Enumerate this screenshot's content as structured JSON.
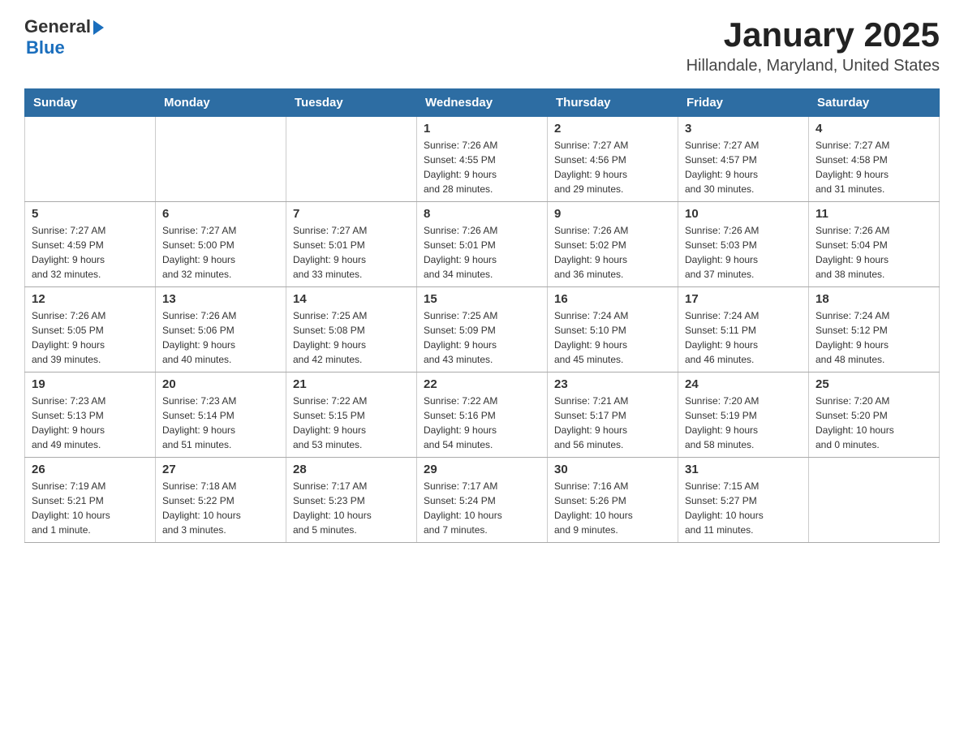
{
  "header": {
    "logo_general": "General",
    "logo_blue": "Blue",
    "title": "January 2025",
    "subtitle": "Hillandale, Maryland, United States"
  },
  "days_of_week": [
    "Sunday",
    "Monday",
    "Tuesday",
    "Wednesday",
    "Thursday",
    "Friday",
    "Saturday"
  ],
  "weeks": [
    [
      {
        "day": "",
        "info": ""
      },
      {
        "day": "",
        "info": ""
      },
      {
        "day": "",
        "info": ""
      },
      {
        "day": "1",
        "info": "Sunrise: 7:26 AM\nSunset: 4:55 PM\nDaylight: 9 hours\nand 28 minutes."
      },
      {
        "day": "2",
        "info": "Sunrise: 7:27 AM\nSunset: 4:56 PM\nDaylight: 9 hours\nand 29 minutes."
      },
      {
        "day": "3",
        "info": "Sunrise: 7:27 AM\nSunset: 4:57 PM\nDaylight: 9 hours\nand 30 minutes."
      },
      {
        "day": "4",
        "info": "Sunrise: 7:27 AM\nSunset: 4:58 PM\nDaylight: 9 hours\nand 31 minutes."
      }
    ],
    [
      {
        "day": "5",
        "info": "Sunrise: 7:27 AM\nSunset: 4:59 PM\nDaylight: 9 hours\nand 32 minutes."
      },
      {
        "day": "6",
        "info": "Sunrise: 7:27 AM\nSunset: 5:00 PM\nDaylight: 9 hours\nand 32 minutes."
      },
      {
        "day": "7",
        "info": "Sunrise: 7:27 AM\nSunset: 5:01 PM\nDaylight: 9 hours\nand 33 minutes."
      },
      {
        "day": "8",
        "info": "Sunrise: 7:26 AM\nSunset: 5:01 PM\nDaylight: 9 hours\nand 34 minutes."
      },
      {
        "day": "9",
        "info": "Sunrise: 7:26 AM\nSunset: 5:02 PM\nDaylight: 9 hours\nand 36 minutes."
      },
      {
        "day": "10",
        "info": "Sunrise: 7:26 AM\nSunset: 5:03 PM\nDaylight: 9 hours\nand 37 minutes."
      },
      {
        "day": "11",
        "info": "Sunrise: 7:26 AM\nSunset: 5:04 PM\nDaylight: 9 hours\nand 38 minutes."
      }
    ],
    [
      {
        "day": "12",
        "info": "Sunrise: 7:26 AM\nSunset: 5:05 PM\nDaylight: 9 hours\nand 39 minutes."
      },
      {
        "day": "13",
        "info": "Sunrise: 7:26 AM\nSunset: 5:06 PM\nDaylight: 9 hours\nand 40 minutes."
      },
      {
        "day": "14",
        "info": "Sunrise: 7:25 AM\nSunset: 5:08 PM\nDaylight: 9 hours\nand 42 minutes."
      },
      {
        "day": "15",
        "info": "Sunrise: 7:25 AM\nSunset: 5:09 PM\nDaylight: 9 hours\nand 43 minutes."
      },
      {
        "day": "16",
        "info": "Sunrise: 7:24 AM\nSunset: 5:10 PM\nDaylight: 9 hours\nand 45 minutes."
      },
      {
        "day": "17",
        "info": "Sunrise: 7:24 AM\nSunset: 5:11 PM\nDaylight: 9 hours\nand 46 minutes."
      },
      {
        "day": "18",
        "info": "Sunrise: 7:24 AM\nSunset: 5:12 PM\nDaylight: 9 hours\nand 48 minutes."
      }
    ],
    [
      {
        "day": "19",
        "info": "Sunrise: 7:23 AM\nSunset: 5:13 PM\nDaylight: 9 hours\nand 49 minutes."
      },
      {
        "day": "20",
        "info": "Sunrise: 7:23 AM\nSunset: 5:14 PM\nDaylight: 9 hours\nand 51 minutes."
      },
      {
        "day": "21",
        "info": "Sunrise: 7:22 AM\nSunset: 5:15 PM\nDaylight: 9 hours\nand 53 minutes."
      },
      {
        "day": "22",
        "info": "Sunrise: 7:22 AM\nSunset: 5:16 PM\nDaylight: 9 hours\nand 54 minutes."
      },
      {
        "day": "23",
        "info": "Sunrise: 7:21 AM\nSunset: 5:17 PM\nDaylight: 9 hours\nand 56 minutes."
      },
      {
        "day": "24",
        "info": "Sunrise: 7:20 AM\nSunset: 5:19 PM\nDaylight: 9 hours\nand 58 minutes."
      },
      {
        "day": "25",
        "info": "Sunrise: 7:20 AM\nSunset: 5:20 PM\nDaylight: 10 hours\nand 0 minutes."
      }
    ],
    [
      {
        "day": "26",
        "info": "Sunrise: 7:19 AM\nSunset: 5:21 PM\nDaylight: 10 hours\nand 1 minute."
      },
      {
        "day": "27",
        "info": "Sunrise: 7:18 AM\nSunset: 5:22 PM\nDaylight: 10 hours\nand 3 minutes."
      },
      {
        "day": "28",
        "info": "Sunrise: 7:17 AM\nSunset: 5:23 PM\nDaylight: 10 hours\nand 5 minutes."
      },
      {
        "day": "29",
        "info": "Sunrise: 7:17 AM\nSunset: 5:24 PM\nDaylight: 10 hours\nand 7 minutes."
      },
      {
        "day": "30",
        "info": "Sunrise: 7:16 AM\nSunset: 5:26 PM\nDaylight: 10 hours\nand 9 minutes."
      },
      {
        "day": "31",
        "info": "Sunrise: 7:15 AM\nSunset: 5:27 PM\nDaylight: 10 hours\nand 11 minutes."
      },
      {
        "day": "",
        "info": ""
      }
    ]
  ]
}
